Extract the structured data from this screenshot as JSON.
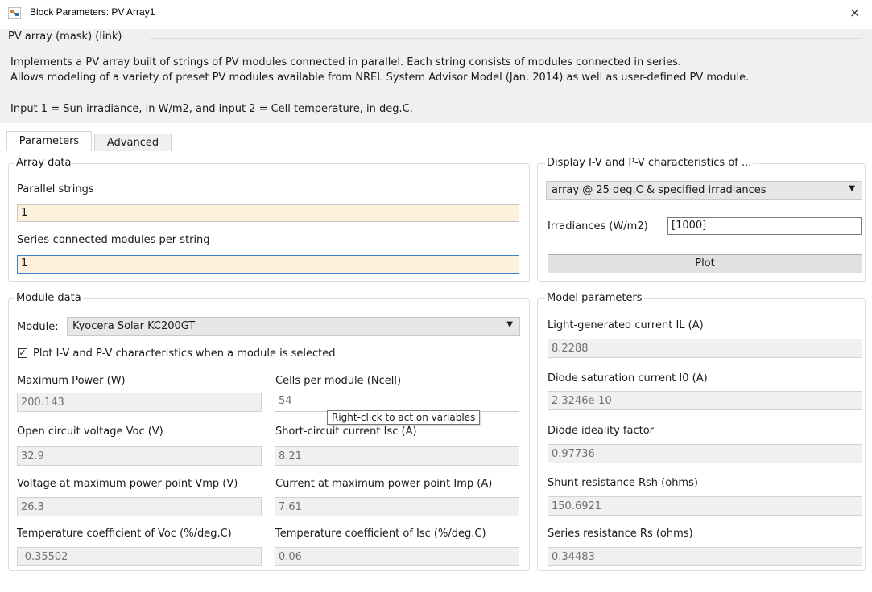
{
  "window": {
    "title": "Block Parameters: PV Array1",
    "close_icon": "×"
  },
  "header": {
    "group_title": "PV array (mask) (link)",
    "desc_line1": "Implements a PV array built of strings of PV modules connected in parallel. Each string consists of modules connected in series.",
    "desc_line2": "Allows modeling of a variety of preset PV modules available from NREL System Advisor Model (Jan. 2014) as well as user-defined PV module.",
    "desc_line3": "Input 1 = Sun irradiance, in W/m2, and input 2 = Cell temperature, in deg.C."
  },
  "tabs": [
    {
      "label": "Parameters",
      "active": true
    },
    {
      "label": "Advanced",
      "active": false
    }
  ],
  "array_data": {
    "title": "Array data",
    "parallel_label": "Parallel strings",
    "parallel_value": "1",
    "series_label": "Series-connected modules per string",
    "series_value": "1"
  },
  "display": {
    "title": "Display  I-V and P-V characteristics of ...",
    "selected": "array @ 25 deg.C & specified irradiances",
    "irradiance_label": "Irradiances (W/m2)",
    "irradiance_value": "[1000]",
    "plot_label": "Plot"
  },
  "module_data": {
    "title": "Module data",
    "module_label": "Module:",
    "module_value": "Kyocera Solar KC200GT",
    "plot_checkbox_label": "Plot I-V and P-V characteristics when a module is selected",
    "plot_checkbox_checked": true,
    "fields": [
      {
        "label": "Maximum Power (W)",
        "value": "200.143"
      },
      {
        "label": "Cells per module (Ncell)",
        "value": "54"
      },
      {
        "label": "Open circuit voltage  Voc (V)",
        "value": "32.9"
      },
      {
        "label": "Short-circuit current Isc (A)",
        "value": "8.21"
      },
      {
        "label": "Voltage at maximum power point Vmp (V)",
        "value": "26.3"
      },
      {
        "label": "Current at maximum power point Imp (A)",
        "value": "7.61"
      },
      {
        "label": "Temperature coefficient of Voc (%/deg.C)",
        "value": "-0.35502"
      },
      {
        "label": "Temperature coefficient of Isc (%/deg.C)",
        "value": "0.06"
      }
    ],
    "tooltip": "Right-click to act on variables"
  },
  "model_params": {
    "title": "Model parameters",
    "fields": [
      {
        "label": "Light-generated current IL (A)",
        "value": "8.2288"
      },
      {
        "label": "Diode saturation current I0 (A)",
        "value": "2.3246e-10"
      },
      {
        "label": "Diode ideality factor",
        "value": "0.97736"
      },
      {
        "label": "Shunt resistance Rsh (ohms)",
        "value": "150.6921"
      },
      {
        "label": "Series resistance Rs (ohms)",
        "value": "0.34483"
      }
    ]
  },
  "colors": {
    "editable_bg": "#fdf0dc",
    "readonly_bg": "#f0f0f0",
    "focus_border": "#3c7fc5"
  }
}
